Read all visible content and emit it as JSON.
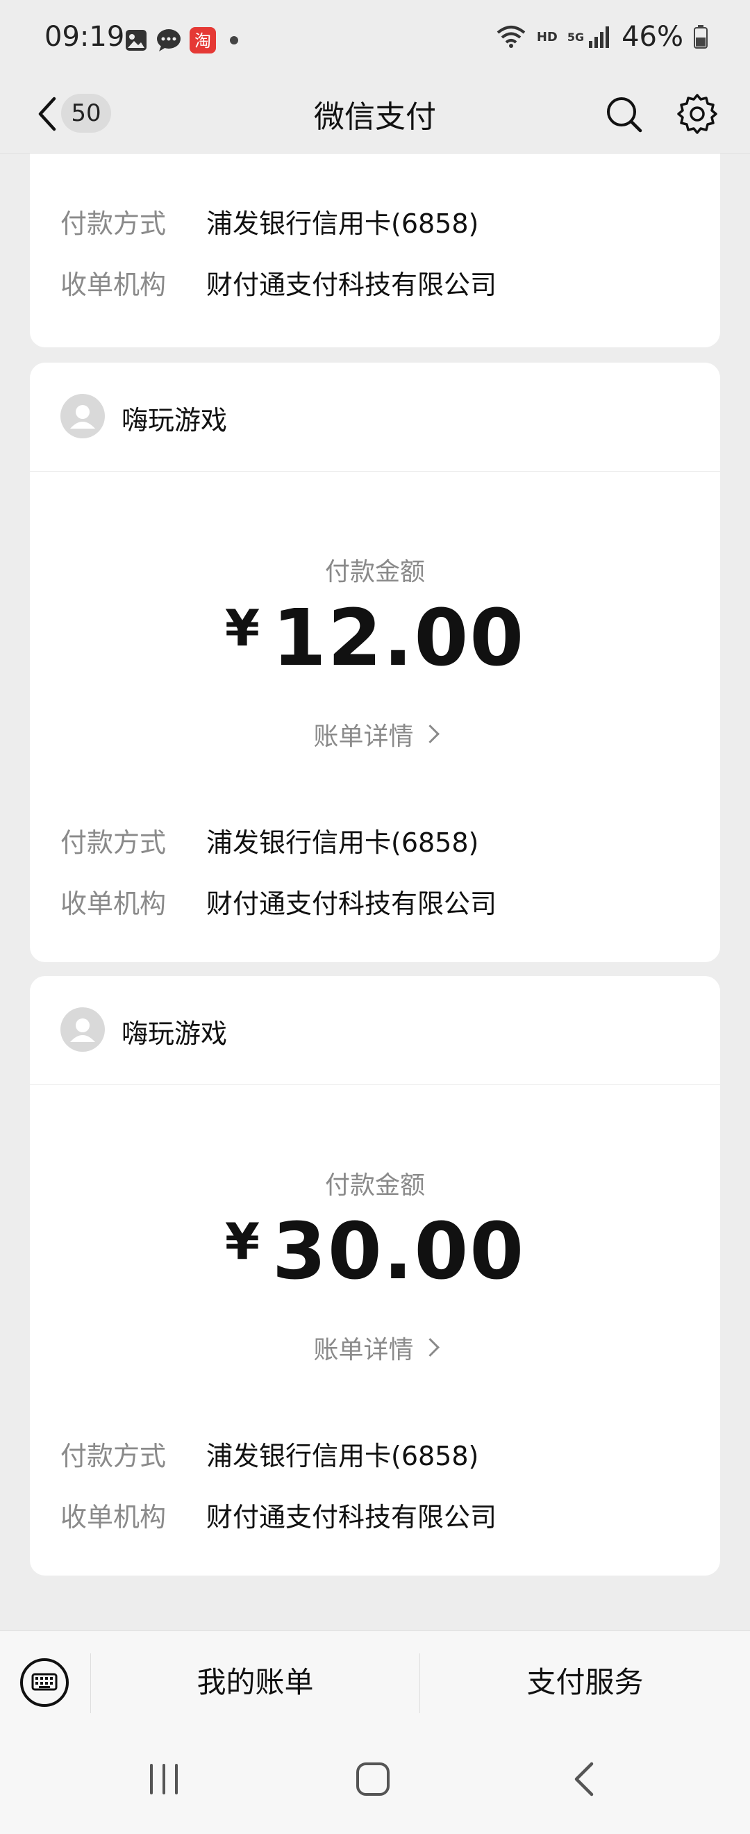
{
  "status_bar": {
    "time": "09:19",
    "signal_label": "5G",
    "hd_label": "HD",
    "battery": "46%"
  },
  "nav": {
    "unread": "50",
    "title": "微信支付"
  },
  "records": [
    {
      "details": [
        {
          "label": "付款方式",
          "value": "浦发银行信用卡(6858)"
        },
        {
          "label": "收单机构",
          "value": "财付通支付科技有限公司"
        }
      ]
    },
    {
      "merchant": "嗨玩游戏",
      "amount_label": "付款金额",
      "currency": "¥",
      "amount": "12.00",
      "bill_link": "账单详情",
      "details": [
        {
          "label": "付款方式",
          "value": "浦发银行信用卡(6858)"
        },
        {
          "label": "收单机构",
          "value": "财付通支付科技有限公司"
        }
      ]
    },
    {
      "merchant": "嗨玩游戏",
      "amount_label": "付款金额",
      "currency": "¥",
      "amount": "30.00",
      "bill_link": "账单详情",
      "details": [
        {
          "label": "付款方式",
          "value": "浦发银行信用卡(6858)"
        },
        {
          "label": "收单机构",
          "value": "财付通支付科技有限公司"
        }
      ]
    }
  ],
  "bottom_menu": {
    "item1": "我的账单",
    "item2": "支付服务"
  },
  "icons": {
    "status": [
      "gallery-icon",
      "chat-bubble-icon",
      "taobao-app-icon",
      "notification-dot-icon",
      "wifi-icon",
      "signal-icon",
      "battery-icon"
    ],
    "nav": [
      "back-arrow-icon",
      "search-icon",
      "settings-gear-icon"
    ],
    "bottom": [
      "keyboard-icon",
      "recents-icon",
      "home-icon",
      "back-icon"
    ]
  },
  "colors": {
    "background": "#ededed",
    "card": "#ffffff",
    "label_gray": "#8a8a8a",
    "taobao_red": "#e53935"
  }
}
